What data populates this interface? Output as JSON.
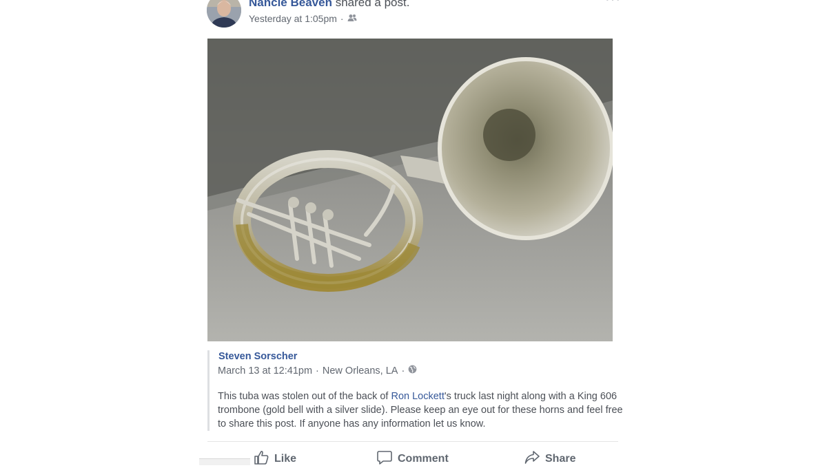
{
  "header": {
    "author": "Nancie Beaven",
    "action": "shared a",
    "object": "post.",
    "timestamp": "Yesterday at 1:05pm",
    "separator": "·",
    "audience_icon": "friends-icon",
    "more_icon": "ellipsis-icon",
    "more_label": "···"
  },
  "photo": {
    "subject_icon": "sousaphone-photo"
  },
  "original_post": {
    "author": "Steven Sorscher",
    "date": "March 13 at 12:41pm",
    "separator": "·",
    "location": "New Orleans, LA",
    "audience_icon": "globe-icon",
    "text_before": "This tuba was stolen out of the back of ",
    "mention": "Ron Lockett",
    "text_after": "'s truck last night along with a King 606 trombone (gold bell with a silver slide). Please keep an eye out for these horns and feel free to share this post. If anyone has any information let us know."
  },
  "actions": {
    "like": "Like",
    "comment": "Comment",
    "share": "Share"
  },
  "colors": {
    "link": "#365899",
    "meta": "#616770",
    "body_text": "#4b4f56",
    "action_text": "#606770",
    "divider": "#e5e5e5"
  }
}
